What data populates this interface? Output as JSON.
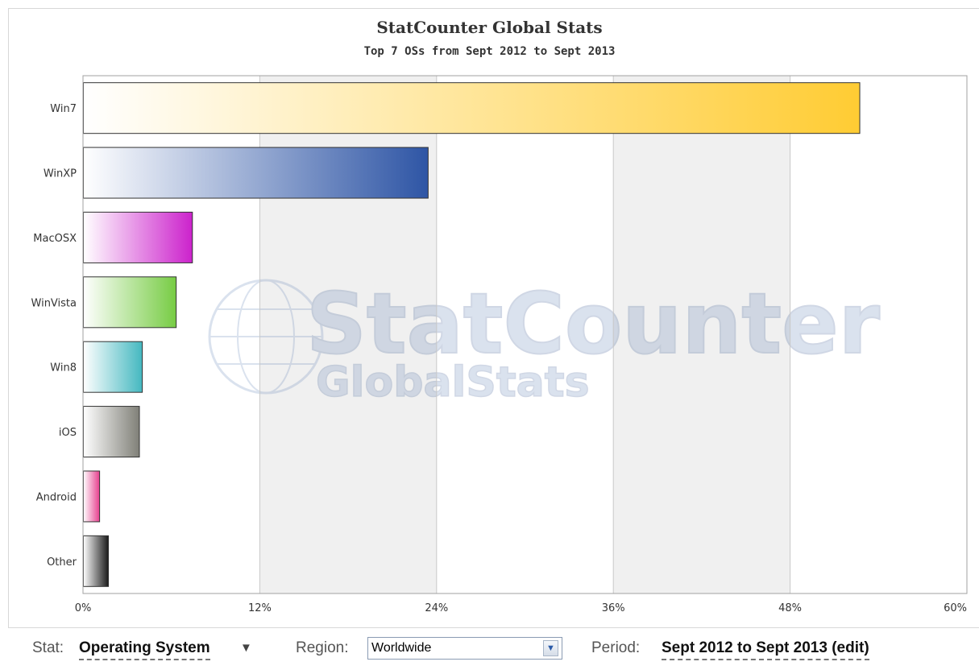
{
  "chart_data": {
    "type": "bar",
    "orientation": "horizontal",
    "title": "StatCounter Global Stats",
    "subtitle": "Top 7 OSs from Sept 2012 to Sept 2013",
    "categories": [
      "Win7",
      "WinXP",
      "MacOSX",
      "WinVista",
      "Win8",
      "iOS",
      "Android",
      "Other"
    ],
    "values": [
      52.7,
      23.4,
      7.4,
      6.3,
      4.0,
      3.8,
      1.1,
      1.7
    ],
    "value_unit": "%",
    "xlim": [
      0,
      60
    ],
    "xticks": [
      "0%",
      "12%",
      "24%",
      "36%",
      "48%",
      "60%"
    ],
    "xtick_values": [
      0,
      12,
      24,
      36,
      48,
      60
    ],
    "grid": true,
    "legend": "none",
    "colors": [
      "#ffcc33",
      "#2e55a5",
      "#cc22cc",
      "#77cc44",
      "#44b8c0",
      "#808078",
      "#e63f8e",
      "#1a1a1a"
    ],
    "watermark": {
      "brand": "StatCounter",
      "sub": "GlobalStats"
    }
  },
  "controls": {
    "stat_label": "Stat:",
    "stat_value": "Operating System",
    "stat_caret": "▼",
    "region_label": "Region:",
    "region_value": "Worldwide",
    "region_button": "▼",
    "period_label": "Period:",
    "period_value": "Sept 2012 to Sept 2013 (edit)"
  }
}
